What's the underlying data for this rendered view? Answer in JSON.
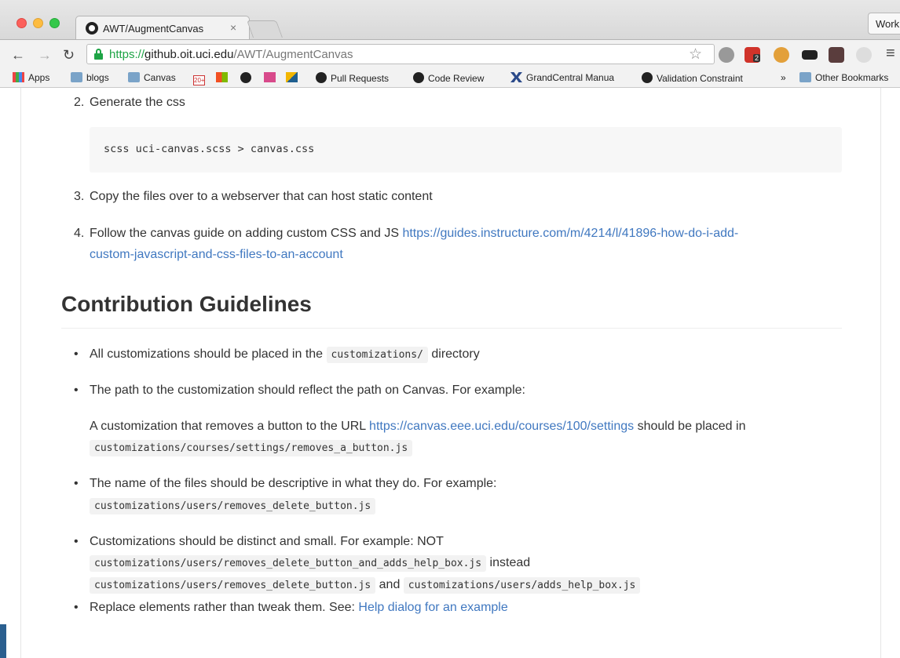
{
  "browser": {
    "tab_title": "AWT/AugmentCanvas",
    "tab_close": "×",
    "profile_label": "Work",
    "url_scheme": "https://",
    "url_host": "github.oit.uci.edu",
    "url_path": "/AWT/AugmentCanvas",
    "bookmarks": [
      {
        "label": "Apps",
        "icon": "apps-grid-icon"
      },
      {
        "label": "blogs",
        "icon": "folder-icon"
      },
      {
        "label": "Canvas",
        "icon": "folder-icon"
      },
      {
        "label": "Pull Requests",
        "icon": "github-icon"
      },
      {
        "label": "Code Review",
        "icon": "github-icon"
      },
      {
        "label": "GrandCentral Manua",
        "icon": "grandcentral-icon"
      },
      {
        "label": "Validation Constraint",
        "icon": "symfony-icon"
      },
      {
        "label": "»",
        "icon": "overflow-chevron-icon"
      },
      {
        "label": "Other Bookmarks",
        "icon": "folder-icon"
      }
    ],
    "gmail_badge": "20+",
    "ext_badge": "2"
  },
  "content": {
    "step2": {
      "num": "2.",
      "text": "Generate the css"
    },
    "code_block": "scss uci-canvas.scss > canvas.css",
    "step3": {
      "num": "3.",
      "text": "Copy the files over to a webserver that can host static content"
    },
    "step4": {
      "num": "4.",
      "text": "Follow the canvas guide on adding custom CSS and JS ",
      "link_line1": "https://guides.instructure.com/m/4214/l/41896-how-do-i-add-",
      "link_line2": "custom-javascript-and-css-files-to-an-account"
    },
    "heading": "Contribution Guidelines",
    "bullets": {
      "b1_pre": "All customizations should be placed in the ",
      "b1_code": "customizations/",
      "b1_post": " directory",
      "b2": "The path to the customization should reflect the path on Canvas. For example:",
      "b2_para_pre": "A customization that removes a button to the URL ",
      "b2_para_link": "https://canvas.eee.uci.edu/courses/100/settings",
      "b2_para_post": " should be placed in",
      "b2_code": "customizations/courses/settings/removes_a_button.js",
      "b3": "The name of the files should be descriptive in what they do. For example:",
      "b3_code": "customizations/users/removes_delete_button.js",
      "b4": "Customizations should be distinct and small. For example: NOT",
      "b4_code1": "customizations/users/removes_delete_button_and_adds_help_box.js",
      "b4_instead": " instead",
      "b4_code2": "customizations/users/removes_delete_button.js",
      "b4_and": " and ",
      "b4_code3": "customizations/users/adds_help_box.js",
      "b5_pre": "Replace elements rather than tweak them. See: ",
      "b5_link": "Help dialog for an example"
    },
    "bullet_char": "•"
  },
  "colors": {
    "link": "#4078c0",
    "secure": "#1ea446",
    "text": "#333333"
  }
}
